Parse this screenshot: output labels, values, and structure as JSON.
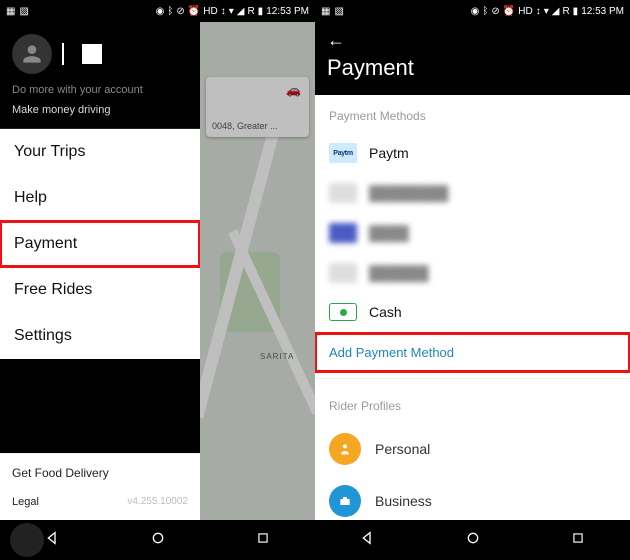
{
  "status": {
    "time": "12:53 PM",
    "hd_label": "HD",
    "r_label": "R"
  },
  "left": {
    "account_hint": "Do more with your account",
    "make_money": "Make money driving",
    "menu": {
      "trips": "Your Trips",
      "help": "Help",
      "payment": "Payment",
      "free_rides": "Free Rides",
      "settings": "Settings"
    },
    "food": "Get Food Delivery",
    "legal": "Legal",
    "version": "v4.255.10002",
    "map": {
      "address_fragment": "0048, Greater ...",
      "label_sarita": "SARITA"
    }
  },
  "right": {
    "title": "Payment",
    "section_methods": "Payment Methods",
    "methods": {
      "paytm_icon": "Paytm",
      "paytm": "Paytm",
      "cash": "Cash"
    },
    "add_method": "Add Payment Method",
    "section_profiles": "Rider Profiles",
    "profiles": {
      "personal": "Personal",
      "business": "Business"
    }
  }
}
